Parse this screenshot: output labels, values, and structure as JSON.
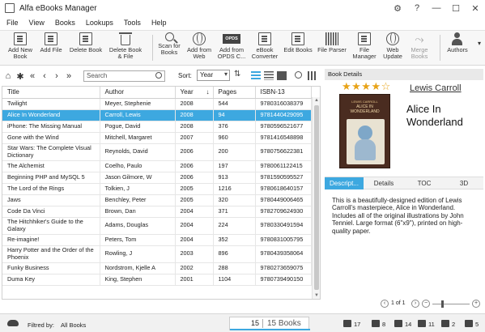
{
  "window": {
    "title": "Alfa eBooks Manager",
    "controls": [
      "⚙",
      "?",
      "—",
      "☐",
      "✕"
    ]
  },
  "menu": [
    "File",
    "View",
    "Books",
    "Lookups",
    "Tools",
    "Help"
  ],
  "toolbar": {
    "add_new_book": [
      "Add New",
      "Book"
    ],
    "add_file": [
      "Add File"
    ],
    "delete_book": [
      "Delete Book"
    ],
    "delete_book_file": [
      "Delete Book",
      "& File"
    ],
    "scan_for_books": [
      "Scan for",
      "Books"
    ],
    "add_from_web": [
      "Add from",
      "Web"
    ],
    "opds_badge": "OPDS",
    "add_from_opds": [
      "Add from",
      "OPDS C..."
    ],
    "ebook_converter": [
      "eBook",
      "Converter"
    ],
    "edit_books": [
      "Edit Books"
    ],
    "file_parser": [
      "File Parser"
    ],
    "file_manager": [
      "File",
      "Manager"
    ],
    "web_update": [
      "Web",
      "Update"
    ],
    "merge_books": [
      "Merge",
      "Books"
    ],
    "authors": [
      "Authors"
    ]
  },
  "nav": {
    "search_placeholder": "Search",
    "sort_label": "Sort:",
    "sort_value": "Year"
  },
  "table": {
    "columns": [
      "Title",
      "Author",
      "Year",
      "Pages",
      "ISBN-13"
    ],
    "sorted_column": "Year",
    "sort_arrow": "↓",
    "rows": [
      [
        "Twilight",
        "Meyer, Stephenie",
        "2008",
        "544",
        "9780316038379"
      ],
      [
        "Alice In Wonderland",
        "Carroll, Lewis",
        "2008",
        "94",
        "9781440429095"
      ],
      [
        "iPhone: The Missing Manual",
        "Pogue, David",
        "2008",
        "376",
        "9780596521677"
      ],
      [
        "Gone with the Wind",
        "Mitchell, Margaret",
        "2007",
        "960",
        "9781416548898"
      ],
      [
        "Star Wars: The Complete Visual Dictionary",
        "Reynolds, David",
        "2006",
        "200",
        "9780756622381"
      ],
      [
        "The Alchemist",
        "Coelho, Paulo",
        "2006",
        "197",
        "9780061122415"
      ],
      [
        "Beginning PHP and MySQL 5",
        "Jason Gilmore, W",
        "2006",
        "913",
        "9781590595527"
      ],
      [
        "The Lord of the Rings",
        "Tolkien, J",
        "2005",
        "1216",
        "9780618640157"
      ],
      [
        "Jaws",
        "Benchley, Peter",
        "2005",
        "320",
        "9780449006465"
      ],
      [
        "Code Da Vinci",
        "Brown, Dan",
        "2004",
        "371",
        "9782709624930"
      ],
      [
        "The Hitchhiker's Guide to the Galaxy",
        "Adams, Douglas",
        "2004",
        "224",
        "9780330491594"
      ],
      [
        "Re-imagine!",
        "Peters, Tom",
        "2004",
        "352",
        "9780831005795"
      ],
      [
        "Harry Potter and the Order of the Phoenix",
        "Rowling, J",
        "2003",
        "896",
        "9780439358064"
      ],
      [
        "Funky Business",
        "Nordstrom, Kjelle A",
        "2002",
        "288",
        "9780273659075"
      ],
      [
        "Duma Key",
        "King, Stephen",
        "2001",
        "1104",
        "9780739490150"
      ]
    ],
    "selected_index": 1
  },
  "details": {
    "header": "Book Details",
    "rating": 4,
    "stars": "★★★★☆",
    "author": "Lewis Carroll",
    "title_lines": [
      "Alice In",
      "Wonderland"
    ],
    "cover_author": "LEWIS CARROLL",
    "cover_title_lines": [
      "ALICE IN",
      "WONDERLAND"
    ],
    "tabs": [
      "Descript...",
      "Details",
      "TOC",
      "3D"
    ],
    "active_tab": 0,
    "description": "This is a beautifully-designed edition of Lewis Carroll's masterpiece, Alice in Wonderland. Includes all of the original illustrations by John Tenniel. Large format (6\"x9\"), printed on high-quality paper.",
    "pager": "1 of 1"
  },
  "status": {
    "filtered_label": "Filtred by:",
    "filtered_value": "All Books",
    "count_current": "15",
    "count_label": "15 Books",
    "stats": [
      "17",
      "8",
      "14",
      "11",
      "2",
      "5"
    ]
  }
}
